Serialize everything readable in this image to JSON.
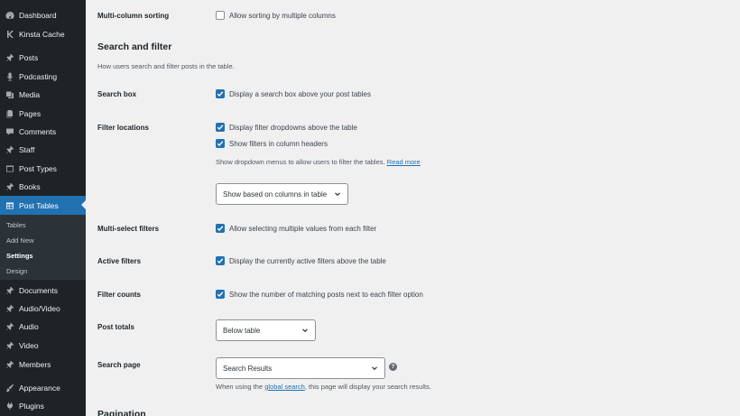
{
  "sidebar": {
    "items": [
      {
        "label": "Dashboard",
        "icon": "dashboard-icon"
      },
      {
        "label": "Kinsta Cache",
        "icon": "kinsta-icon"
      },
      {
        "label": "Posts",
        "icon": "pin-icon"
      },
      {
        "label": "Podcasting",
        "icon": "microphone-icon"
      },
      {
        "label": "Media",
        "icon": "media-icon"
      },
      {
        "label": "Pages",
        "icon": "pages-icon"
      },
      {
        "label": "Comments",
        "icon": "comment-icon"
      },
      {
        "label": "Staff",
        "icon": "pin-icon"
      },
      {
        "label": "Post Types",
        "icon": "post-types-icon"
      },
      {
        "label": "Books",
        "icon": "pin-icon"
      },
      {
        "label": "Post Tables",
        "icon": "table-icon"
      },
      {
        "label": "Documents",
        "icon": "pin-icon"
      },
      {
        "label": "Audio/Video",
        "icon": "pin-icon"
      },
      {
        "label": "Audio",
        "icon": "pin-icon"
      },
      {
        "label": "Video",
        "icon": "pin-icon"
      },
      {
        "label": "Members",
        "icon": "pin-icon"
      },
      {
        "label": "Appearance",
        "icon": "brush-icon"
      },
      {
        "label": "Plugins",
        "icon": "plugin-icon"
      }
    ],
    "submenu": [
      {
        "label": "Tables"
      },
      {
        "label": "Add New"
      },
      {
        "label": "Settings"
      },
      {
        "label": "Design"
      }
    ]
  },
  "settings": {
    "multi_column": {
      "label": "Multi-column sorting",
      "option": "Allow sorting by multiple columns",
      "checked": false
    },
    "search_filter": {
      "title": "Search and filter",
      "description": "How users search and filter posts in the table."
    },
    "search_box": {
      "label": "Search box",
      "option": "Display a search box above your post tables",
      "checked": true
    },
    "filter_locations": {
      "label": "Filter locations",
      "option1": "Display filter dropdowns above the table",
      "option2": "Show filters in column headers",
      "hint": "Show dropdown menus to allow users to filter the tables.",
      "read_more": "Read more",
      "select_value": "Show based on columns in table"
    },
    "multi_select": {
      "label": "Multi-select filters",
      "option": "Allow selecting multiple values from each filter",
      "checked": true
    },
    "active_filters": {
      "label": "Active filters",
      "option": "Display the currently active filters above the table",
      "checked": true
    },
    "filter_counts": {
      "label": "Filter counts",
      "option": "Show the number of matching posts next to each filter option",
      "checked": true
    },
    "post_totals": {
      "label": "Post totals",
      "select_value": "Below table"
    },
    "search_page": {
      "label": "Search page",
      "select_value": "Search Results",
      "help": "?",
      "hint_before": "When using the",
      "hint_link": "global search",
      "hint_after": ", this page will display your search results."
    },
    "pagination": {
      "title": "Pagination"
    }
  },
  "colors": {
    "accent": "#2271b1",
    "sidebar_bg": "#1d2327",
    "page_bg": "#f0f0f1"
  }
}
